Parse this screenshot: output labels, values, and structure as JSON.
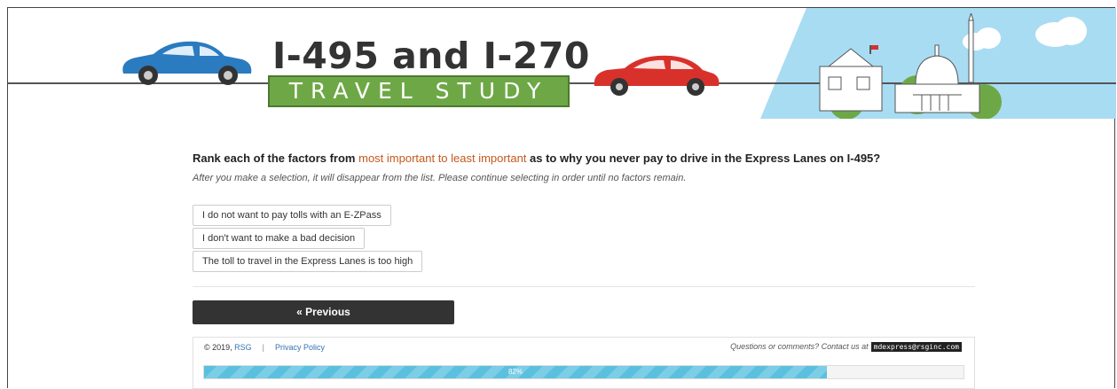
{
  "banner": {
    "title": "I-495 and I-270",
    "subtitle": "TRAVEL STUDY"
  },
  "question": {
    "prefix": "Rank each of the factors from ",
    "emphasis": "most important to least important",
    "suffix": " as to why you never pay to drive in the Express Lanes on I-495?",
    "hint": "After you make a selection, it will disappear from the list. Please continue selecting in order until no factors remain."
  },
  "options": [
    "I do not want to pay tolls with an E-ZPass",
    "I don't want to make a bad decision",
    "The toll to travel in the Express Lanes is too high"
  ],
  "nav": {
    "previous_label": "« Previous"
  },
  "footer": {
    "copyright": "© 2019, ",
    "company_link": "RSG",
    "separator": "|",
    "privacy_link": "Privacy Policy",
    "contact_text": "Questions or comments? Contact us at",
    "email": "mdexpress@rsginc.com"
  },
  "progress": {
    "percent": 82,
    "label": "82%"
  },
  "colors": {
    "accent_orange": "#c4581c",
    "title_green": "#6ea846",
    "car_blue": "#2a7bbf",
    "car_red": "#d8312b",
    "sky_blue": "#a8dcf2",
    "progress_blue": "#5bc0de"
  }
}
